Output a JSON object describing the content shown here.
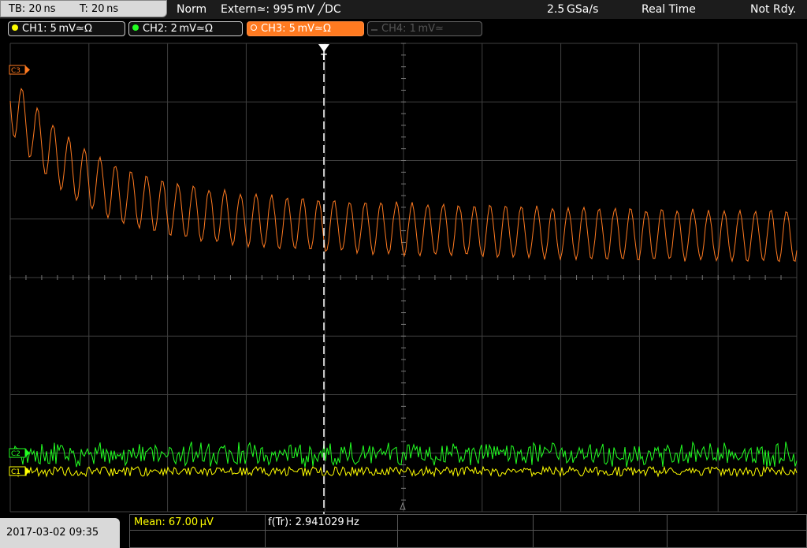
{
  "header": {
    "timebase": "TB: 20 ns",
    "trigger_time": "T: 20 ns",
    "mode": "Norm",
    "trigger_source": "Extern≃: 995 mV ╱DC",
    "sample_rate": "2.5 GSa/s",
    "acq_mode": "Real Time",
    "status": "Not Rdy."
  },
  "channels": [
    {
      "label": "CH1: 5 mV≃Ω",
      "color": "#ffff00",
      "state": "on"
    },
    {
      "label": "CH2: 2 mV≃Ω",
      "color": "#22ff22",
      "state": "on"
    },
    {
      "label": "CH3: 5 mV≃Ω",
      "color": "#ff7a20",
      "state": "selected"
    },
    {
      "label": "CH4: 1 mV≃",
      "color": "#555555",
      "state": "off"
    }
  ],
  "markers": {
    "ch3": "C3",
    "ch2": "C2",
    "ch1": "C1",
    "trigger": "T"
  },
  "footer": {
    "datetime": "2017-03-02 09:35",
    "measurement_mean": "Mean: 67.00 µV",
    "measurement_freq": "f(Tr): 2.941029 Hz"
  },
  "colors": {
    "grid": "#404040",
    "ch1": "#ffff00",
    "ch2": "#22ff22",
    "ch3": "#ff7a20",
    "trigger_line": "#ffffff"
  },
  "chart_data": {
    "type": "line",
    "grid": true,
    "divisions": {
      "x": 10,
      "y": 8
    },
    "series": [
      {
        "name": "CH3",
        "description": "damped oscillation decaying toward baseline"
      },
      {
        "name": "CH2",
        "description": "noise"
      },
      {
        "name": "CH1",
        "description": "noise"
      }
    ]
  }
}
